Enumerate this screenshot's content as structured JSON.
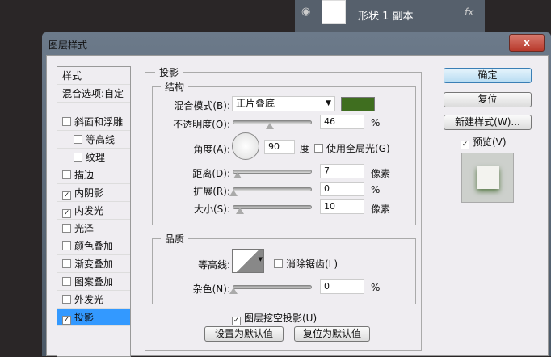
{
  "layers_panel": {
    "layer_name": "形状 1 副本",
    "fx_label": "fx"
  },
  "dialog": {
    "title": "图层样式",
    "close": "x"
  },
  "styles_list": {
    "header": "样式",
    "blend_options": "混合选项:自定",
    "items": [
      {
        "label": "斜面和浮雕",
        "checked": false,
        "indent": false
      },
      {
        "label": "等高线",
        "checked": false,
        "indent": true
      },
      {
        "label": "纹理",
        "checked": false,
        "indent": true
      },
      {
        "label": "描边",
        "checked": false,
        "indent": false
      },
      {
        "label": "内阴影",
        "checked": true,
        "indent": false
      },
      {
        "label": "内发光",
        "checked": true,
        "indent": false
      },
      {
        "label": "光泽",
        "checked": false,
        "indent": false
      },
      {
        "label": "颜色叠加",
        "checked": false,
        "indent": false
      },
      {
        "label": "渐变叠加",
        "checked": false,
        "indent": false
      },
      {
        "label": "图案叠加",
        "checked": false,
        "indent": false
      },
      {
        "label": "外发光",
        "checked": false,
        "indent": false
      },
      {
        "label": "投影",
        "checked": true,
        "indent": false,
        "selected": true
      }
    ]
  },
  "drop_shadow": {
    "title": "投影",
    "structure": {
      "title": "结构",
      "blend_mode_label": "混合模式(B):",
      "blend_mode": "正片叠底",
      "color": "#3f6e1f",
      "opacity_label": "不透明度(O):",
      "opacity": "46",
      "opacity_unit": "%",
      "angle_label": "角度(A):",
      "angle": "90",
      "angle_unit": "度",
      "global_light_label": "使用全局光(G)",
      "global_light": false,
      "distance_label": "距离(D):",
      "distance": "7",
      "distance_unit": "像素",
      "spread_label": "扩展(R):",
      "spread": "0",
      "spread_unit": "%",
      "size_label": "大小(S):",
      "size": "10",
      "size_unit": "像素"
    },
    "quality": {
      "title": "品质",
      "contour_label": "等高线:",
      "anti_alias_label": "消除锯齿(L)",
      "anti_alias": false,
      "noise_label": "杂色(N):",
      "noise": "0",
      "noise_unit": "%"
    },
    "knockout_label": "图层挖空投影(U)",
    "knockout": true,
    "make_default": "设置为默认值",
    "reset_default": "复位为默认值"
  },
  "buttons": {
    "ok": "确定",
    "reset": "复位",
    "new_style": "新建样式(W)...",
    "preview_label": "预览(V)",
    "preview": true
  }
}
